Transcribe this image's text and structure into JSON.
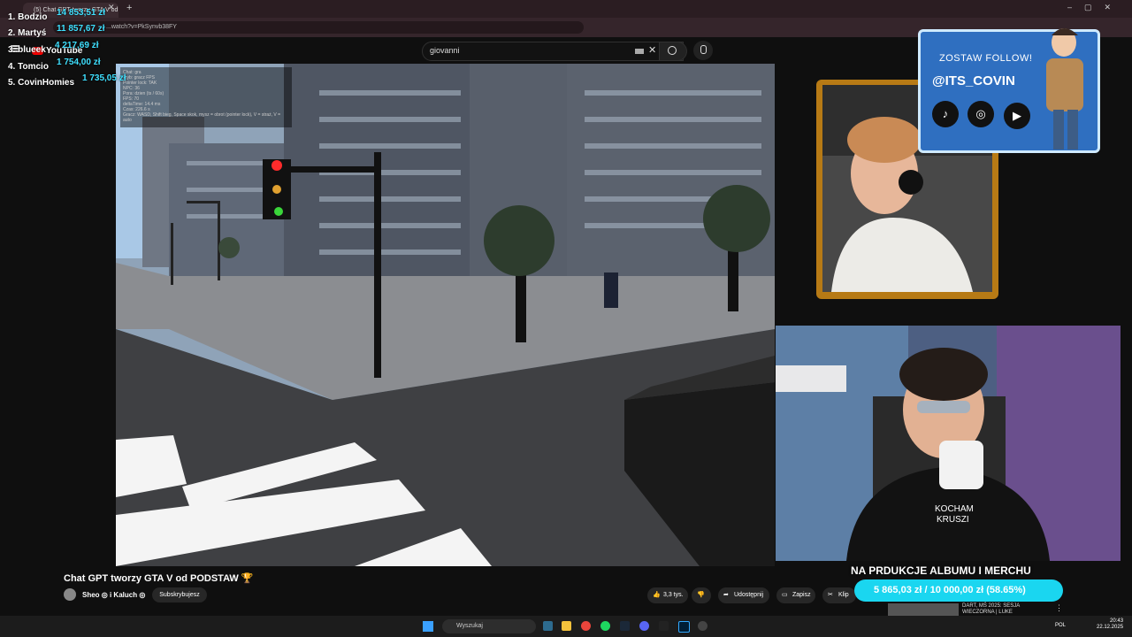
{
  "browser": {
    "tab_title": "(5) Chat GPT tworzy GTA V od...",
    "url": "...watch?v=PkSynvb38FY"
  },
  "youtube": {
    "logo": "YouTube",
    "search_value": "giovanni",
    "video_title": "Chat GPT tworzy GTA V od PODSTAW 🏆",
    "channel": "Sheo ◎ i Kaluch ◎",
    "subscribe_label": "Subskrybujesz",
    "likes": "3,3 tys.",
    "share_label": "Udostępnij",
    "save_label": "Zapisz",
    "clip_label": "Klip"
  },
  "game_debug": {
    "lines": [
      "Chat: gra",
      "Tryb: gracz FPS",
      "Pointer lock: TAK",
      "NPC: 36",
      "Pora: dzien (ts / 60s)",
      "FPS: 70",
      "deltaTime: 14.4 ms",
      "Czas: 226.6 s",
      "Gracz: WASD, Shift bieg, Space skok, mysz = obrot (pointer lock), V = straż, V = auto"
    ]
  },
  "leaderboard": [
    {
      "rank_name": "1. Bodzio",
      "amount": "14 853,51 zł"
    },
    {
      "rank_name": "2. Martyś",
      "amount": "11 857,67 zł"
    },
    {
      "rank_name": "3. blueek",
      "amount": "4 217,69 zł"
    },
    {
      "rank_name": "4. Tomcio",
      "amount": "1 754,00 zł"
    },
    {
      "rank_name": "5. CovinHomies",
      "amount": "1 735,05 zł"
    }
  ],
  "banner": {
    "title": "ZOSTAW FOLLOW!",
    "handle": "@ITS_COVIN",
    "icons": [
      "tiktok-icon",
      "instagram-icon",
      "youtube-icon"
    ]
  },
  "donation": {
    "title": "NA PRDUKCJE ALBUMU I MERCHU",
    "progress_text": "5 865,03 zł / 10 000,00 zł (58.65%)",
    "progress": 0.5865
  },
  "recommendation": {
    "line1": "DART, MŚ 2025: SESJA",
    "line2": "WIECZORNA | LUKE"
  },
  "taskbar": {
    "search_label": "Wyszukaj",
    "lang": "POL",
    "time": "20:43",
    "date": "22.12.2025"
  },
  "colors": {
    "accent_cyan": "#3fe0ff",
    "donation_bar": "#1ad6f0",
    "youtube_red": "#ff0000",
    "cam_frame": "#b77a15"
  }
}
